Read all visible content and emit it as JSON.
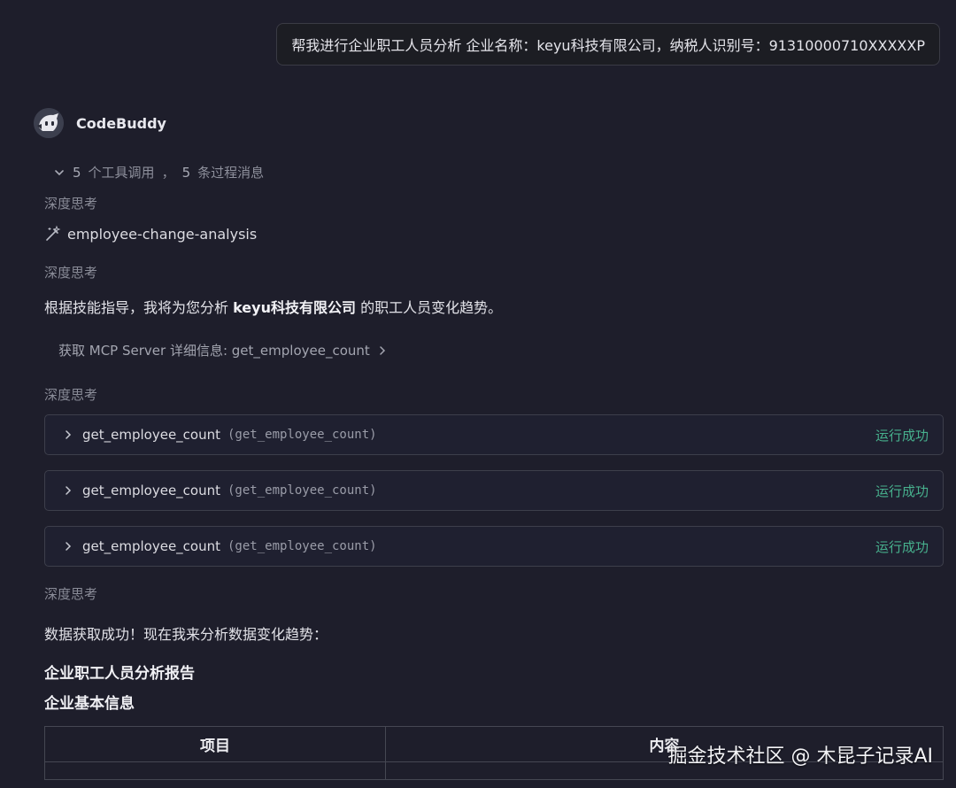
{
  "user_message": "帮我进行企业职工人员分析 企业名称：keyu科技有限公司，纳税人识别号：91310000710XXXXXP",
  "assistant": {
    "name": "CodeBuddy",
    "avatar_icon": "robot-avatar-icon"
  },
  "summary": {
    "tool_count": "5",
    "tool_text": "个工具调用",
    "separator": "，",
    "process_count": "5",
    "process_text": "条过程消息"
  },
  "thinking_label": "深度思考",
  "skill": {
    "icon": "wand-icon",
    "name": "employee-change-analysis"
  },
  "intro": {
    "prefix": "根据技能指导，我将为您分析 ",
    "company": "keyu科技有限公司",
    "suffix": " 的职工人员变化趋势。"
  },
  "mcp_detail": {
    "label": "获取 MCP Server 详细信息: get_employee_count"
  },
  "tool_calls": [
    {
      "name": "get_employee_count",
      "arg": "(get_employee_count)",
      "status": "运行成功"
    },
    {
      "name": "get_employee_count",
      "arg": "(get_employee_count)",
      "status": "运行成功"
    },
    {
      "name": "get_employee_count",
      "arg": "(get_employee_count)",
      "status": "运行成功"
    }
  ],
  "result_text": "数据获取成功！现在我来分析数据变化趋势：",
  "report_title": "企业职工人员分析报告",
  "section_title": "企业基本信息",
  "table": {
    "headers": [
      "项目",
      "内容"
    ]
  },
  "watermark": "掘金技术社区 @ 木昆子记录AI",
  "colors": {
    "background": "#1e1e2b",
    "success": "#47b08d"
  }
}
